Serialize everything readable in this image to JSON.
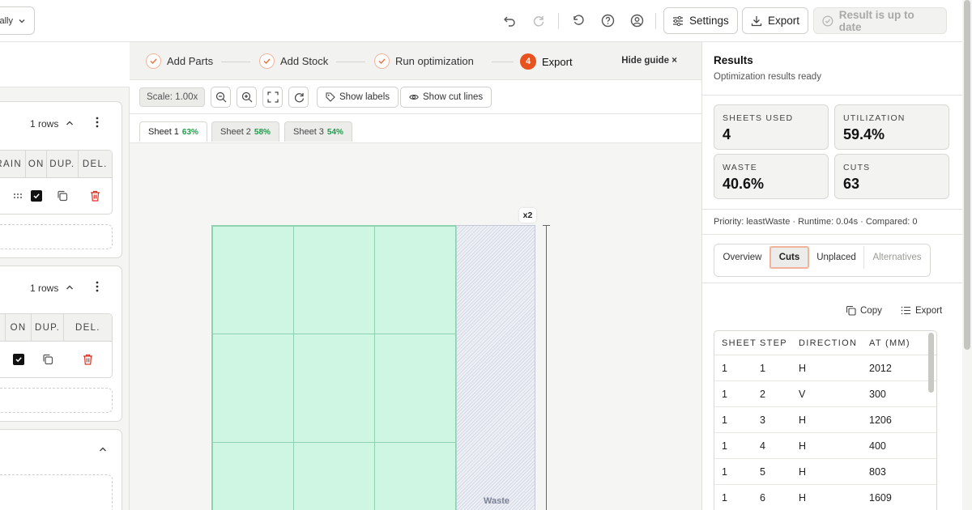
{
  "topbar": {
    "mode_select": "ally",
    "settings_label": "Settings",
    "export_label": "Export",
    "status_label": "Result is up to date"
  },
  "left": {
    "card1": {
      "rows": "1 rows",
      "columns": [
        "RAIN",
        "ON",
        "DUP.",
        "DEL."
      ]
    },
    "card2": {
      "rows": "1 rows",
      "columns": [
        "ON",
        "DUP.",
        "DEL."
      ]
    }
  },
  "guide": {
    "steps": [
      {
        "label": "Add Parts",
        "state": "done"
      },
      {
        "label": "Add Stock",
        "state": "done"
      },
      {
        "label": "Run optimization",
        "state": "done"
      },
      {
        "label": "Export",
        "state": "active",
        "number": "4"
      }
    ],
    "hide_label": "Hide guide ×"
  },
  "toolbar": {
    "scale": "Scale: 1.00x",
    "show_labels": "Show labels",
    "show_cut_lines": "Show cut lines"
  },
  "sheets": [
    {
      "label": "Sheet 1",
      "pct": "63%"
    },
    {
      "label": "Sheet 2",
      "pct": "58%"
    },
    {
      "label": "Sheet 3",
      "pct": "54%"
    }
  ],
  "canvas": {
    "multiplier": "x2",
    "waste_label": "Waste"
  },
  "results": {
    "title": "Results",
    "subtitle": "Optimization results ready",
    "stats": [
      {
        "label": "SHEETS USED",
        "value": "4"
      },
      {
        "label": "UTILIZATION",
        "value": "59.4%"
      },
      {
        "label": "WASTE",
        "value": "40.6%"
      },
      {
        "label": "CUTS",
        "value": "63"
      }
    ],
    "meta": "Priority: leastWaste · Runtime: 0.04s · Compared: 0",
    "tabs": [
      "Overview",
      "Cuts",
      "Unplaced",
      "Alternatives"
    ],
    "copy_label": "Copy",
    "export_label": "Export",
    "table": {
      "columns": [
        "SHEET",
        "STEP",
        "DIRECTION",
        "AT (MM)"
      ],
      "rows": [
        [
          "1",
          "1",
          "H",
          "2012"
        ],
        [
          "1",
          "2",
          "V",
          "300"
        ],
        [
          "1",
          "3",
          "H",
          "1206"
        ],
        [
          "1",
          "4",
          "H",
          "400"
        ],
        [
          "1",
          "5",
          "H",
          "803"
        ],
        [
          "1",
          "6",
          "H",
          "1609"
        ]
      ]
    }
  },
  "colors": {
    "accent": "#e8521e",
    "part_fill": "#cff6e3",
    "pct_green": "#1e9b4a"
  }
}
